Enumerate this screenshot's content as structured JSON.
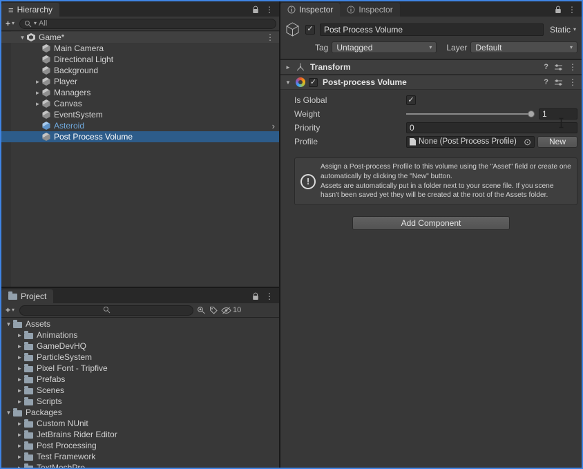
{
  "colors": {
    "focus_border": "#3f84e4",
    "selection": "#2d5c8a",
    "prefab_text": "#6fa8dc",
    "panel_bg": "#383838",
    "tabbar_bg": "#282828"
  },
  "hierarchy": {
    "tab_label": "Hierarchy",
    "add_label": "+",
    "search_filter": "All",
    "rows": [
      {
        "label": "Game*",
        "depth": 0,
        "arrow": "expanded",
        "icon": "scene",
        "kind": "scene",
        "kebab": true
      },
      {
        "label": "Main Camera",
        "depth": 1,
        "arrow": "none",
        "icon": "gameobject"
      },
      {
        "label": "Directional Light",
        "depth": 1,
        "arrow": "none",
        "icon": "gameobject"
      },
      {
        "label": "Background",
        "depth": 1,
        "arrow": "none",
        "icon": "gameobject"
      },
      {
        "label": "Player",
        "depth": 1,
        "arrow": "collapsed",
        "icon": "gameobject"
      },
      {
        "label": "Managers",
        "depth": 1,
        "arrow": "collapsed",
        "icon": "gameobject"
      },
      {
        "label": "Canvas",
        "depth": 1,
        "arrow": "collapsed",
        "icon": "gameobject"
      },
      {
        "label": "EventSystem",
        "depth": 1,
        "arrow": "none",
        "icon": "gameobject"
      },
      {
        "label": "Asteroid",
        "depth": 1,
        "arrow": "none",
        "icon": "prefab",
        "prefab": true,
        "chevron": true
      },
      {
        "label": "Post Process Volume",
        "depth": 1,
        "arrow": "none",
        "icon": "gameobject",
        "selected": true
      }
    ]
  },
  "project": {
    "tab_label": "Project",
    "add_label": "+",
    "hidden_count": "10",
    "rows": [
      {
        "label": "Assets",
        "depth": 0,
        "arrow": "expanded",
        "icon": "folder"
      },
      {
        "label": "Animations",
        "depth": 1,
        "arrow": "collapsed",
        "icon": "folder"
      },
      {
        "label": "GameDevHQ",
        "depth": 1,
        "arrow": "collapsed",
        "icon": "folder"
      },
      {
        "label": "ParticleSystem",
        "depth": 1,
        "arrow": "collapsed",
        "icon": "folder"
      },
      {
        "label": "Pixel Font - Tripfive",
        "depth": 1,
        "arrow": "collapsed",
        "icon": "folder"
      },
      {
        "label": "Prefabs",
        "depth": 1,
        "arrow": "collapsed",
        "icon": "folder"
      },
      {
        "label": "Scenes",
        "depth": 1,
        "arrow": "collapsed",
        "icon": "folder"
      },
      {
        "label": "Scripts",
        "depth": 1,
        "arrow": "collapsed",
        "icon": "folder"
      },
      {
        "label": "Packages",
        "depth": 0,
        "arrow": "expanded",
        "icon": "folder"
      },
      {
        "label": "Custom NUnit",
        "depth": 1,
        "arrow": "collapsed",
        "icon": "folder"
      },
      {
        "label": "JetBrains Rider Editor",
        "depth": 1,
        "arrow": "collapsed",
        "icon": "folder"
      },
      {
        "label": "Post Processing",
        "depth": 1,
        "arrow": "collapsed",
        "icon": "folder"
      },
      {
        "label": "Test Framework",
        "depth": 1,
        "arrow": "collapsed",
        "icon": "folder"
      },
      {
        "label": "TextMeshPro",
        "depth": 1,
        "arrow": "collapsed",
        "icon": "folder"
      }
    ]
  },
  "inspector": {
    "tabs": [
      {
        "label": "Inspector"
      },
      {
        "label": "Inspector"
      }
    ],
    "header": {
      "name": "Post Process Volume",
      "static_label": "Static",
      "tag_label": "Tag",
      "tag_value": "Untagged",
      "layer_label": "Layer",
      "layer_value": "Default"
    },
    "transform_title": "Transform",
    "ppv_title": "Post-process Volume",
    "fields": {
      "is_global_label": "Is Global",
      "weight_label": "Weight",
      "weight_value": "1",
      "priority_label": "Priority",
      "priority_value": "0",
      "profile_label": "Profile",
      "profile_value": "None (Post Process Profile)",
      "new_button": "New"
    },
    "help": {
      "line1": "Assign a Post-process Profile to this volume using the \"Asset\" field or create one automatically by clicking the \"New\" button.",
      "line2": "Assets are automatically put in a folder next to your scene file. If you scene hasn't been saved yet they will be created at the root of the Assets folder."
    },
    "add_component": "Add Component"
  }
}
